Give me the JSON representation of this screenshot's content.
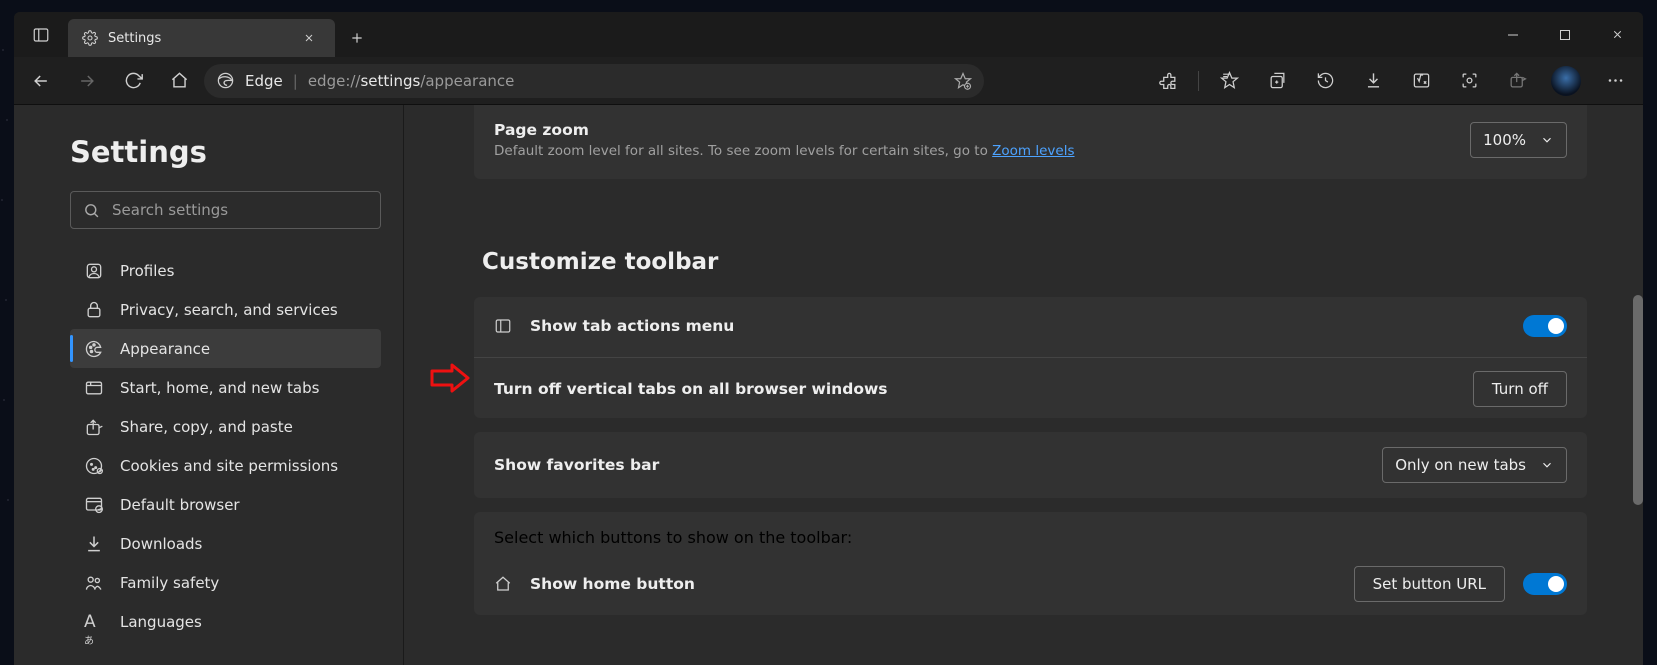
{
  "tab": {
    "title": "Settings"
  },
  "urlbar": {
    "brand": "Edge",
    "path_dim": "edge://",
    "path_bold": "settings",
    "path_dim2": "/appearance"
  },
  "sidebar": {
    "heading": "Settings",
    "search_placeholder": "Search settings",
    "items": [
      {
        "label": "Profiles"
      },
      {
        "label": "Privacy, search, and services"
      },
      {
        "label": "Appearance"
      },
      {
        "label": "Start, home, and new tabs"
      },
      {
        "label": "Share, copy, and paste"
      },
      {
        "label": "Cookies and site permissions"
      },
      {
        "label": "Default browser"
      },
      {
        "label": "Downloads"
      },
      {
        "label": "Family safety"
      },
      {
        "label": "Languages"
      }
    ]
  },
  "main": {
    "zoom": {
      "title": "Page zoom",
      "desc_pre": "Default zoom level for all sites. To see zoom levels for certain sites, go to ",
      "link": "Zoom levels",
      "value": "100%"
    },
    "section_title": "Customize toolbar",
    "tab_actions": {
      "label": "Show tab actions menu"
    },
    "vertical_tabs": {
      "label": "Turn off vertical tabs on all browser windows",
      "button": "Turn off"
    },
    "favorites": {
      "label": "Show favorites bar",
      "value": "Only on new tabs"
    },
    "toolbar_buttons": {
      "heading": "Select which buttons to show on the toolbar:",
      "home": {
        "label": "Show home button",
        "button": "Set button URL"
      }
    }
  }
}
